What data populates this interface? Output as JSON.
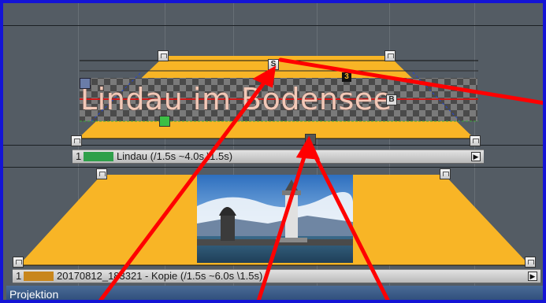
{
  "title_overlay": {
    "text": "Lindau im Bodensee",
    "text_color": "#f2c9b8"
  },
  "tracks": [
    {
      "number": "1",
      "label": "Lindau (/1.5s ~4.0s \\1.5s)",
      "color": "#2fa04a"
    },
    {
      "number": "1",
      "label": "20170812_183321 - Kopie (/1.5s ~6.0s \\1.5s)",
      "color": "#c8861c"
    }
  ],
  "handles": {
    "start_label": "S",
    "end_label": "B",
    "marker3": "3"
  },
  "status_bar": {
    "label": "Projektion"
  },
  "colors": {
    "border": "#1414d6",
    "background": "#545c64",
    "fade_shape": "#f8b526",
    "annotation_arrow": "#ff0000"
  },
  "icons": {
    "track_expand": "triangle-right-icon",
    "photo": "lindau-harbor-photo"
  }
}
